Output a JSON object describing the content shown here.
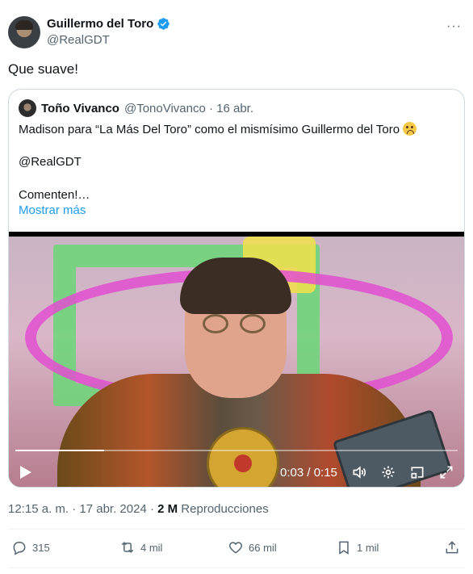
{
  "author": {
    "name": "Guillermo del Toro",
    "handle": "@RealGDT"
  },
  "tweet": {
    "text": "Que suave!"
  },
  "quote": {
    "name": "Toño Vivanco",
    "meta": "@TonoVivanco · 16 abr.",
    "line1": "Madison para “La Más Del Toro” como el mismísimo Guillermo del Toro",
    "line2": "@RealGDT",
    "line3": "Comenten!…",
    "show_more": "Mostrar más"
  },
  "video": {
    "time": "0:03 / 0:15",
    "progress": 0.2
  },
  "details": {
    "timestamp": "12:15 a. m. · 17 abr. 2024 · ",
    "views": "2 M",
    "views_label": " Reproducciones"
  },
  "actions": {
    "replies": "315",
    "reposts": "4 mil",
    "likes": "66 mil",
    "bookmarks": "1 mil"
  },
  "colors": {
    "accent": "#1d9bf0",
    "secondary_text": "#536471",
    "primary_text": "#0f1419"
  }
}
